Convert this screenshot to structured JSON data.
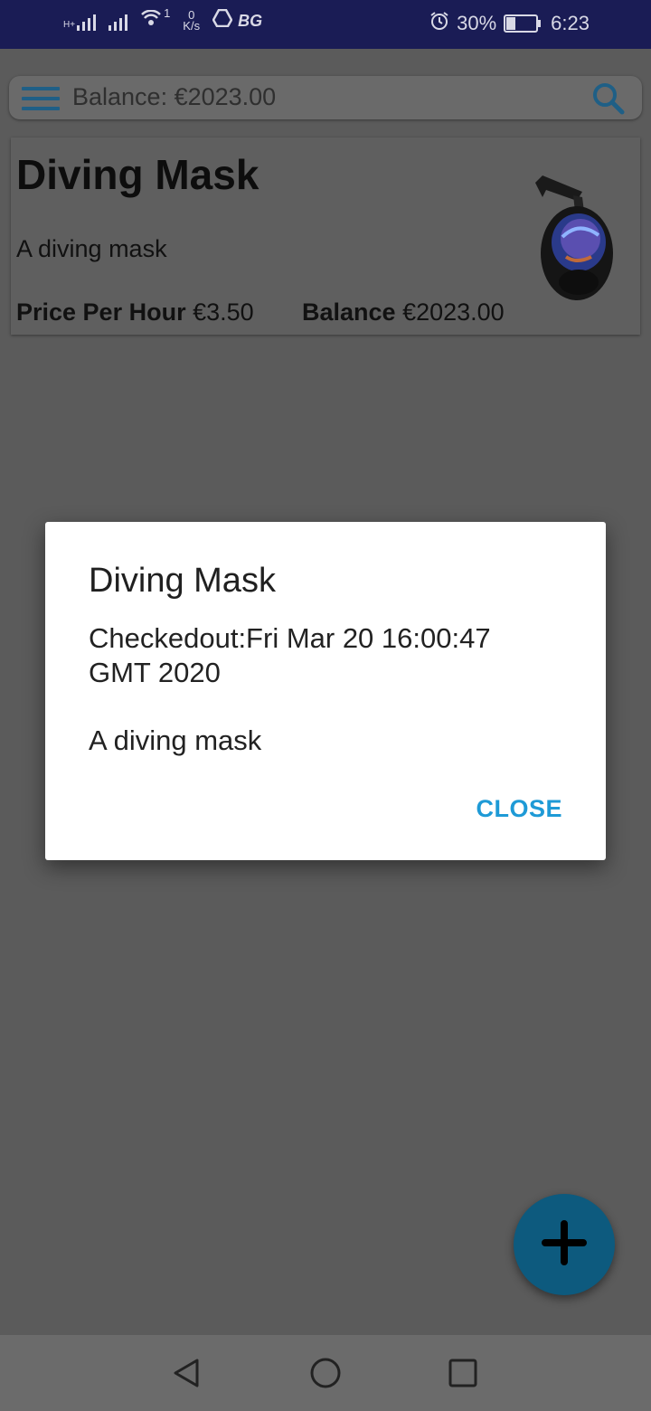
{
  "status_bar": {
    "network_small": "H+",
    "wifi_badge": "1",
    "speed_value": "0",
    "speed_unit": "K/s",
    "vpn_label": "BG",
    "battery_percent": "30%",
    "battery_level": 0.3,
    "time": "6:23",
    "icons": [
      "signal-icon",
      "signal-icon",
      "wifi-icon",
      "drive-icon",
      "alarm-icon",
      "battery-icon"
    ]
  },
  "search_bar": {
    "text": "Balance: €2023.00",
    "menu_icon": "hamburger-menu-icon",
    "search_icon": "search-icon"
  },
  "item_card": {
    "title": "Diving Mask",
    "description": "A diving mask",
    "price_label": "Price Per Hour",
    "price_value": "€3.50",
    "balance_label": "Balance",
    "balance_value": "€2023.00"
  },
  "dialog": {
    "title": "Diving Mask",
    "body": "Checkedout:Fri Mar 20 16:00:47 GMT 2020",
    "description": "A diving mask",
    "close_label": "CLOSE"
  },
  "fab": {
    "icon": "plus-icon"
  },
  "nav_bar": {
    "icons": [
      "back-icon",
      "home-icon",
      "recents-icon"
    ]
  },
  "colors": {
    "status_bar": "#1a1c55",
    "scrim": "#5b5b5b",
    "accent": "#1e9ad6",
    "fab": "#0d5a7e"
  }
}
